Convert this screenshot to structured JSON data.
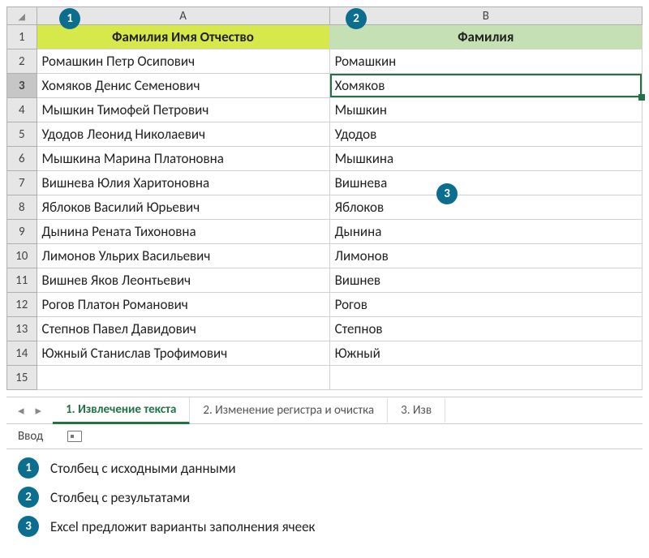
{
  "columns": {
    "a_label": "A",
    "b_label": "B"
  },
  "headers": {
    "col_a": "Фамилия Имя Отчество",
    "col_b": "Фамилия"
  },
  "rows": [
    {
      "n": "1"
    },
    {
      "n": "2",
      "a": "Ромашкин Петр Осипович",
      "b": "Ромашкин",
      "suggested": false
    },
    {
      "n": "3",
      "a": "Хомяков Денис Семенович",
      "b": "Хомяков",
      "suggested": false,
      "active": true
    },
    {
      "n": "4",
      "a": "Мышкин Тимофей Петрович",
      "b": "Мышкин",
      "suggested": true
    },
    {
      "n": "5",
      "a": "Удодов Леонид Николаевич",
      "b": "Удодов",
      "suggested": true
    },
    {
      "n": "6",
      "a": "Мышкина Марина Платоновна",
      "b": "Мышкина",
      "suggested": true
    },
    {
      "n": "7",
      "a": "Вишнева Юлия Харитоновна",
      "b": "Вишнева",
      "suggested": true
    },
    {
      "n": "8",
      "a": "Яблоков Василий Юрьевич",
      "b": "Яблоков",
      "suggested": true
    },
    {
      "n": "9",
      "a": "Дынина Рената Тихоновна",
      "b": "Дынина",
      "suggested": true
    },
    {
      "n": "10",
      "a": "Лимонов Ульрих Васильевич",
      "b": "Лимонов",
      "suggested": true
    },
    {
      "n": "11",
      "a": "Вишнев Яков Леонтьевич",
      "b": "Вишнев",
      "suggested": true
    },
    {
      "n": "12",
      "a": "Рогов Платон Романович",
      "b": "Рогов",
      "suggested": true
    },
    {
      "n": "13",
      "a": "Степнов Павел Давидович",
      "b": "Степнов",
      "suggested": true
    },
    {
      "n": "14",
      "a": "Южный Станислав Трофимович",
      "b": "Южный",
      "suggested": true
    },
    {
      "n": "15",
      "a": "",
      "b": ""
    }
  ],
  "tabs": {
    "nav_prev": "◂",
    "nav_next": "▸",
    "items": [
      {
        "label": "1. Извлечение текста",
        "active": true
      },
      {
        "label": "2. Изменение регистра и очистка",
        "active": false
      },
      {
        "label": "3. Изв",
        "active": false
      }
    ]
  },
  "status": {
    "mode": "Ввод"
  },
  "callouts": {
    "c1": "1",
    "c2": "2",
    "c3": "3"
  },
  "legend": [
    {
      "n": "1",
      "text": "Столбец с исходными данными"
    },
    {
      "n": "2",
      "text": "Столбец с результатами"
    },
    {
      "n": "3",
      "text": "Excel предложит варианты заполнения ячеек"
    }
  ],
  "colors": {
    "accent_green": "#217346",
    "header_a": "#d7e84a",
    "header_b": "#c5e0b3",
    "callout": "#0b6e8f"
  }
}
